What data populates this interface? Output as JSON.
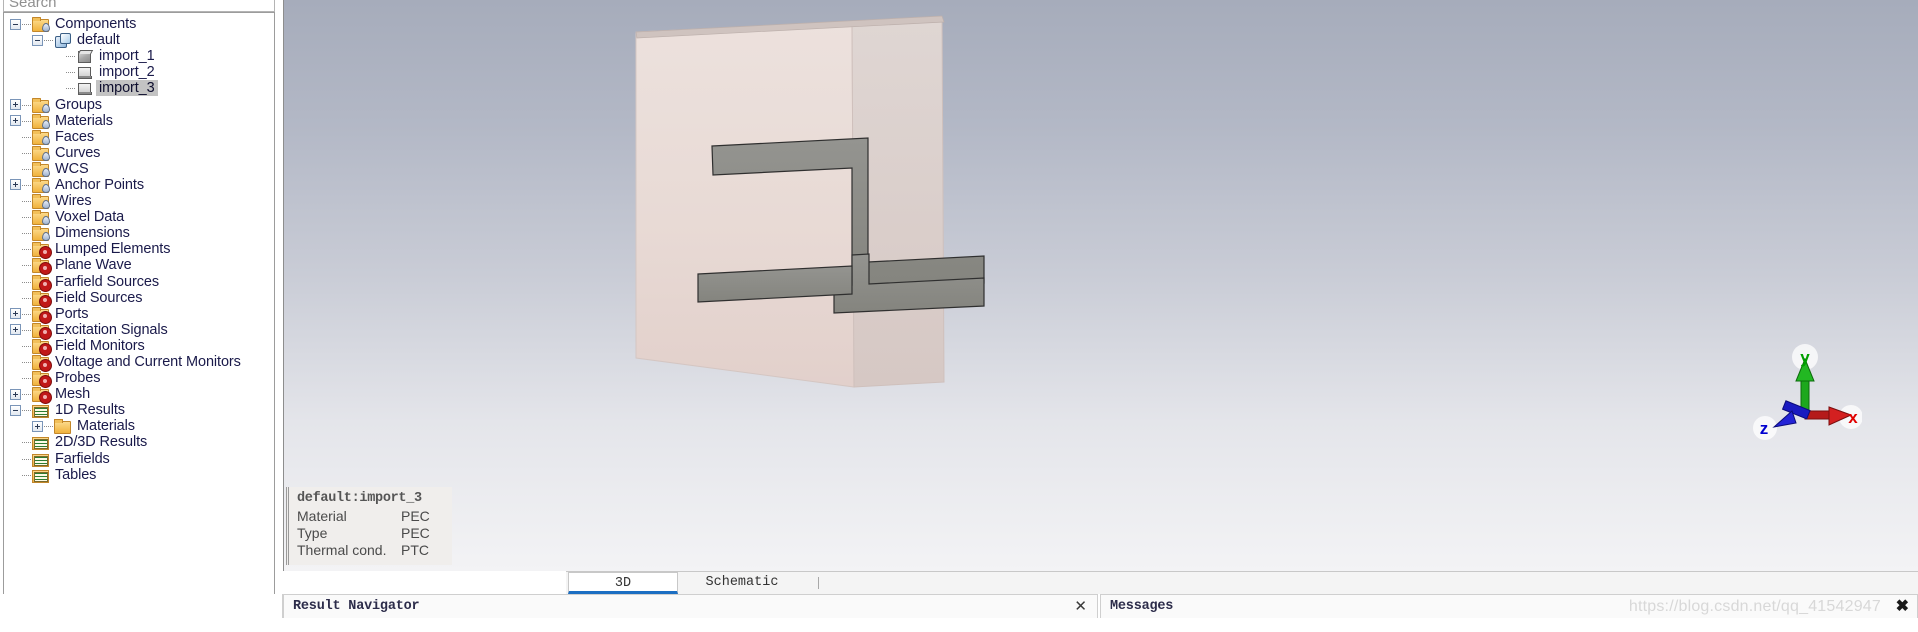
{
  "search": {
    "placeholder": "Search"
  },
  "tree": {
    "items": [
      {
        "label": "Components",
        "depth": 0,
        "expander": "minus",
        "icon": "folder-droplet-icon",
        "selected": false
      },
      {
        "label": "default",
        "depth": 1,
        "expander": "minus",
        "icon": "component-cube-icon",
        "selected": false
      },
      {
        "label": "import_1",
        "depth": 2,
        "expander": "none",
        "icon": "solid-cube-icon",
        "selected": false
      },
      {
        "label": "import_2",
        "depth": 2,
        "expander": "none",
        "icon": "sheet-solid-icon",
        "selected": false
      },
      {
        "label": "import_3",
        "depth": 2,
        "expander": "none",
        "icon": "sheet-solid-icon",
        "selected": true
      },
      {
        "label": "Groups",
        "depth": 0,
        "expander": "plus",
        "icon": "folder-droplet-icon",
        "selected": false
      },
      {
        "label": "Materials",
        "depth": 0,
        "expander": "plus",
        "icon": "folder-droplet-icon",
        "selected": false
      },
      {
        "label": "Faces",
        "depth": 0,
        "expander": "none",
        "icon": "folder-droplet-icon",
        "selected": false
      },
      {
        "label": "Curves",
        "depth": 0,
        "expander": "none",
        "icon": "folder-droplet-icon",
        "selected": false
      },
      {
        "label": "WCS",
        "depth": 0,
        "expander": "none",
        "icon": "folder-droplet-icon",
        "selected": false
      },
      {
        "label": "Anchor Points",
        "depth": 0,
        "expander": "plus",
        "icon": "folder-droplet-icon",
        "selected": false
      },
      {
        "label": "Wires",
        "depth": 0,
        "expander": "none",
        "icon": "folder-droplet-icon",
        "selected": false
      },
      {
        "label": "Voxel Data",
        "depth": 0,
        "expander": "none",
        "icon": "folder-droplet-icon",
        "selected": false
      },
      {
        "label": "Dimensions",
        "depth": 0,
        "expander": "none",
        "icon": "folder-droplet-icon",
        "selected": false
      },
      {
        "label": "Lumped Elements",
        "depth": 0,
        "expander": "none",
        "icon": "folder-gear-icon",
        "selected": false
      },
      {
        "label": "Plane Wave",
        "depth": 0,
        "expander": "none",
        "icon": "folder-gear-icon",
        "selected": false
      },
      {
        "label": "Farfield Sources",
        "depth": 0,
        "expander": "none",
        "icon": "folder-gear-icon",
        "selected": false
      },
      {
        "label": "Field Sources",
        "depth": 0,
        "expander": "none",
        "icon": "folder-gear-icon",
        "selected": false
      },
      {
        "label": "Ports",
        "depth": 0,
        "expander": "plus",
        "icon": "folder-gear-icon",
        "selected": false
      },
      {
        "label": "Excitation Signals",
        "depth": 0,
        "expander": "plus",
        "icon": "folder-gear-icon",
        "selected": false
      },
      {
        "label": "Field Monitors",
        "depth": 0,
        "expander": "none",
        "icon": "folder-gear-icon",
        "selected": false
      },
      {
        "label": "Voltage and Current Monitors",
        "depth": 0,
        "expander": "none",
        "icon": "folder-gear-icon",
        "selected": false
      },
      {
        "label": "Probes",
        "depth": 0,
        "expander": "none",
        "icon": "folder-gear-icon",
        "selected": false
      },
      {
        "label": "Mesh",
        "depth": 0,
        "expander": "plus",
        "icon": "folder-gear-icon",
        "selected": false
      },
      {
        "label": "1D Results",
        "depth": 0,
        "expander": "minus",
        "icon": "results-curve-icon",
        "selected": false
      },
      {
        "label": "Materials",
        "depth": 1,
        "expander": "plus",
        "icon": "plain-folder-icon",
        "selected": false
      },
      {
        "label": "2D/3D Results",
        "depth": 0,
        "expander": "none",
        "icon": "results-curve-icon",
        "selected": false
      },
      {
        "label": "Farfields",
        "depth": 0,
        "expander": "none",
        "icon": "results-curve-icon",
        "selected": false
      },
      {
        "label": "Tables",
        "depth": 0,
        "expander": "none",
        "icon": "results-curve-icon",
        "selected": false
      }
    ]
  },
  "viewport": {
    "info_box": {
      "title": "default:import_3",
      "rows": [
        {
          "key": "Material",
          "value": "PEC"
        },
        {
          "key": "Type",
          "value": "PEC"
        },
        {
          "key": "Thermal cond.",
          "value": "PTC"
        }
      ]
    },
    "axis_gizmo": {
      "x_label": "x",
      "y_label": "y",
      "z_label": "z",
      "x_color": "#e00000",
      "y_color": "#00a000",
      "z_color": "#0000d0"
    },
    "colors": {
      "background_top": "#a6acbb",
      "background_bottom": "#f3f3f5",
      "substrate": "#e7dad6",
      "trace": "#8c8c86"
    }
  },
  "tabs": {
    "items": [
      {
        "label": "3D",
        "active": true
      },
      {
        "label": "Schematic",
        "active": false
      }
    ]
  },
  "bottom": {
    "result_navigator": {
      "title": "Result Navigator",
      "close": "✕"
    },
    "messages": {
      "title": "Messages",
      "close": "✖"
    },
    "watermark": "https://blog.csdn.net/qq_41542947"
  }
}
